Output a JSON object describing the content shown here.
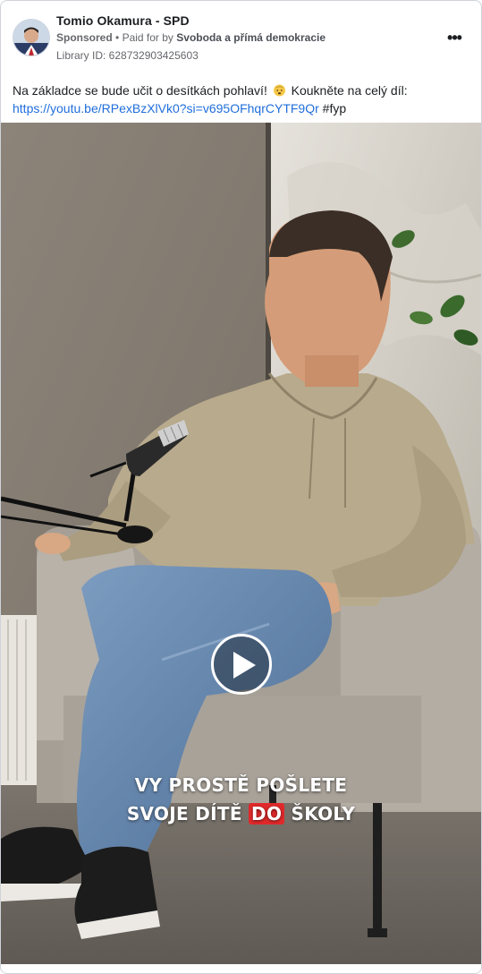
{
  "post": {
    "author": "Tomio Okamura - SPD",
    "sponsored_label": "Sponsored",
    "separator": "•",
    "paid_for_prefix": "Paid for by",
    "payer": "Svoboda a přímá demokracie",
    "library_id": "Library ID: 628732903425603",
    "more_icon": "more-options-icon",
    "text_part1": "Na základce se bude učit o desítkách pohlaví!",
    "emoji": "face-emoji",
    "text_part2": "Koukněte na celý díl:",
    "link": "https://youtu.be/RPexBzXlVk0?si=v695OFhqrCYTF9Qr",
    "hashtag": "#fyp"
  },
  "video": {
    "caption_line1": "VY PROSTĚ POŠLETE",
    "caption_line2_before": "SVOJE DÍTĚ",
    "caption_line2_highlight": "DO",
    "caption_line2_after": "ŠKOLY",
    "play_icon": "play-icon",
    "highlight_color": "#e0292b"
  },
  "colors": {
    "link": "#216fdb",
    "text": "#1c1e21",
    "secondary": "#65676b"
  }
}
